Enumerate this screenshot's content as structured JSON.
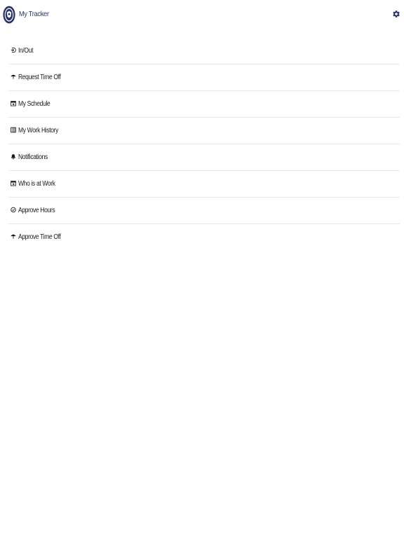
{
  "header": {
    "title": "My Tracker",
    "logo_icon": "org-seal-logo",
    "settings_icon": "gear-icon"
  },
  "colors": {
    "brand": "#2a3366",
    "divider": "#e6e6e6",
    "text": "#1a1a1a",
    "background": "#ffffff"
  },
  "menu": {
    "items": [
      {
        "label": "In/Out",
        "icon": "clock-in-icon"
      },
      {
        "label": "Request Time Off",
        "icon": "umbrella-icon"
      },
      {
        "label": "My Schedule",
        "icon": "calendar-icon"
      },
      {
        "label": "My Work History",
        "icon": "history-book-icon"
      },
      {
        "label": "Notifications",
        "icon": "bell-icon"
      },
      {
        "label": "Who is at Work",
        "icon": "calendar-icon"
      },
      {
        "label": "Approve Hours",
        "icon": "check-circle-icon"
      },
      {
        "label": "Approve Time Off",
        "icon": "umbrella-icon"
      }
    ]
  }
}
